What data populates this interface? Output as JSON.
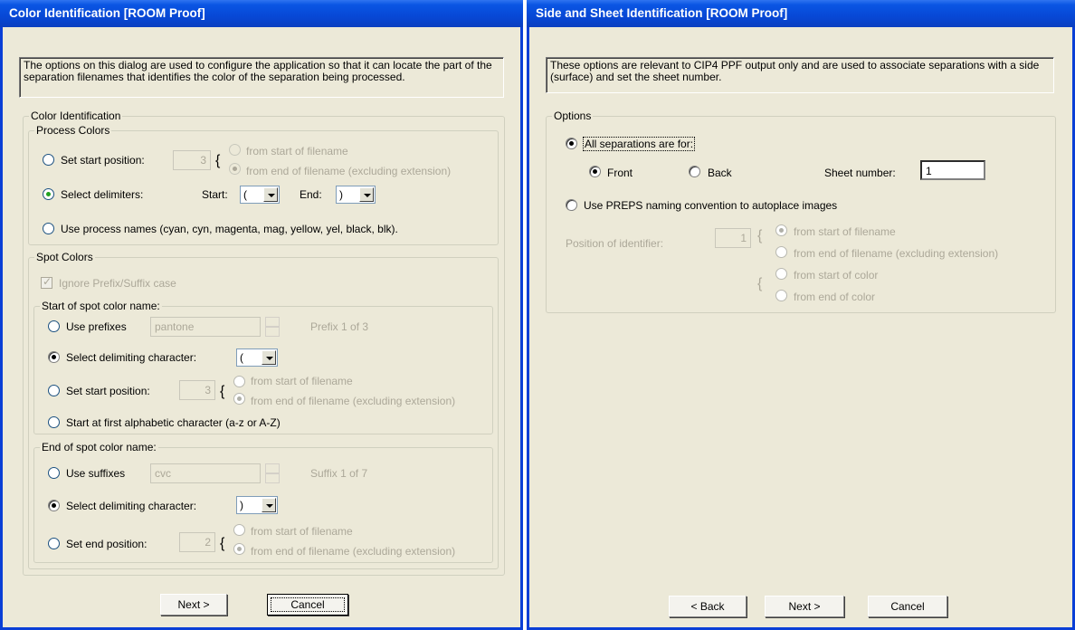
{
  "left": {
    "title": "Color Identification [ROOM Proof]",
    "description": "The options on this dialog are used to configure the application so that it can locate the part of the separation filenames that identifies the color of the separation being processed.",
    "color_identification_label": "Color Identification",
    "process_colors": {
      "label": "Process Colors",
      "set_start_position_label": "Set start position:",
      "start_position_value": "3",
      "from_start_label": "from start of filename",
      "from_end_label": "from end of filename (excluding extension)",
      "select_delimiters_label": "Select delimiters:",
      "start_label": "Start:",
      "start_value": "(",
      "end_label": "End:",
      "end_value": ")",
      "use_process_names_label": "Use process names (cyan, cyn, magenta, mag, yellow, yel, black, blk)."
    },
    "spot_colors": {
      "label": "Spot Colors",
      "ignore_case_label": "Ignore Prefix/Suffix case",
      "start_group": {
        "label": "Start of spot color name:",
        "use_prefixes_label": "Use prefixes",
        "prefix_value": "pantone",
        "prefix_counter": "Prefix 1 of 3",
        "select_delimiting_label": "Select delimiting character:",
        "delimiting_value": "(",
        "set_start_position_label": "Set start position:",
        "start_position_value": "3",
        "from_start_label": "from start of filename",
        "from_end_label": "from end of filename (excluding extension)",
        "first_alpha_label": "Start at first alphabetic character (a-z or A-Z)"
      },
      "end_group": {
        "label": "End of spot color name:",
        "use_suffixes_label": "Use suffixes",
        "suffix_value": "cvc",
        "suffix_counter": "Suffix 1 of 7",
        "select_delimiting_label": "Select delimiting character:",
        "delimiting_value": ")",
        "set_end_position_label": "Set end position:",
        "end_position_value": "2",
        "from_start_label": "from start of filename",
        "from_end_label": "from end of filename (excluding extension)"
      }
    },
    "buttons": {
      "next": "Next >",
      "cancel": "Cancel"
    }
  },
  "right": {
    "title": "Side and Sheet Identification [ROOM Proof]",
    "description": "These options are relevant to CIP4 PPF output only and are used to associate separations with a side (surface) and set the sheet number.",
    "options_label": "Options",
    "all_separations_label": "All separations are for:",
    "front_label": "Front",
    "back_label": "Back",
    "sheet_number_label": "Sheet number:",
    "sheet_number_value": "1",
    "use_preps_label": "Use PREPS naming convention to autoplace images",
    "position_identifier_label": "Position of identifier:",
    "position_identifier_value": "1",
    "from_start_filename": "from start of filename",
    "from_end_filename": "from end of filename (excluding extension)",
    "from_start_color": "from start of color",
    "from_end_color": "from end of color",
    "buttons": {
      "back": "< Back",
      "next": "Next >",
      "cancel": "Cancel"
    }
  },
  "colors": {
    "titlebar": "#0a55e3",
    "dialog_bg": "#ece9d8",
    "disabled_text": "#aca899",
    "selected_radio": "#21a121"
  }
}
